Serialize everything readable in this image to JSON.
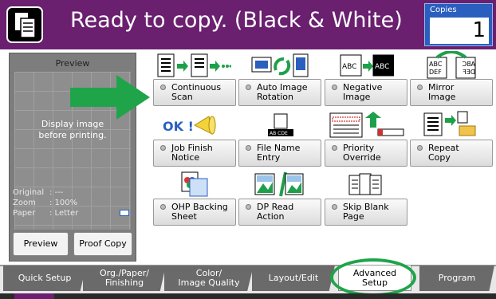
{
  "header": {
    "title": "Ready to copy. (Black & White)",
    "copies_label": "Copies",
    "copies_value": "1",
    "colors": {
      "bar": "#6a1f6f",
      "copies_box": "#2b5fbf"
    }
  },
  "preview": {
    "title": "Preview",
    "message_line1": "Display image",
    "message_line2": "before printing.",
    "info": [
      {
        "key": "Original",
        "value": ": ---"
      },
      {
        "key": "Zoom",
        "value": ": 100%"
      },
      {
        "key": "Paper",
        "value": ": Letter"
      }
    ],
    "preview_button": "Preview",
    "proof_copy_button": "Proof Copy"
  },
  "functions": [
    {
      "line1": "Continuous",
      "line2": "Scan",
      "icon": "continuous-scan-icon"
    },
    {
      "line1": "Auto Image",
      "line2": "Rotation",
      "icon": "auto-rotation-icon"
    },
    {
      "line1": "Negative",
      "line2": "Image",
      "icon": "negative-image-icon"
    },
    {
      "line1": "Mirror",
      "line2": "Image",
      "icon": "mirror-image-icon"
    },
    {
      "line1": "Job Finish",
      "line2": "Notice",
      "icon": "job-finish-notice-icon"
    },
    {
      "line1": "File Name",
      "line2": "Entry",
      "icon": "file-name-entry-icon"
    },
    {
      "line1": "Priority",
      "line2": "Override",
      "icon": "priority-override-icon"
    },
    {
      "line1": "Repeat",
      "line2": "Copy",
      "icon": "repeat-copy-icon"
    },
    {
      "line1": "OHP Backing",
      "line2": "Sheet",
      "icon": "ohp-backing-icon"
    },
    {
      "line1": "DP Read",
      "line2": "Action",
      "icon": "dp-read-icon"
    },
    {
      "line1": "Skip Blank",
      "line2": "Page",
      "icon": "skip-blank-icon"
    }
  ],
  "icon_texts": {
    "abc": "ABC",
    "def": "DEF",
    "ok": "OK !",
    "ab_cde": "AB CDE"
  },
  "tabs": [
    {
      "line1": "Quick Setup",
      "line2": ""
    },
    {
      "line1": "Org./Paper/",
      "line2": "Finishing"
    },
    {
      "line1": "Color/",
      "line2": "Image Quality"
    },
    {
      "line1": "Layout/Edit",
      "line2": ""
    },
    {
      "line1": "Advanced",
      "line2": "Setup"
    },
    {
      "line1": "Program",
      "line2": ""
    }
  ],
  "annotation_color": "#1fa44a"
}
